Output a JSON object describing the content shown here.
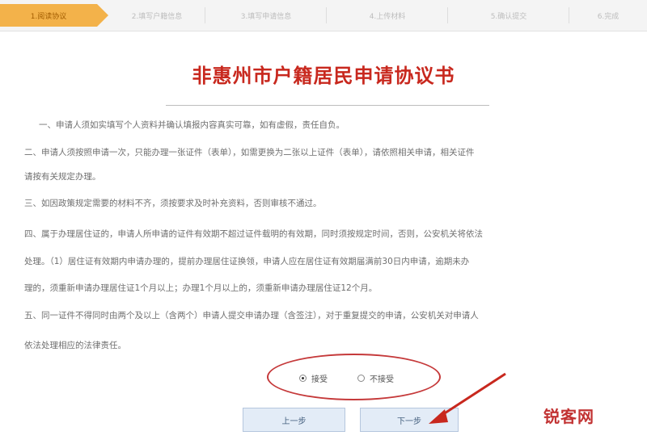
{
  "steps": [
    {
      "label": "1.阅读协议"
    },
    {
      "label": "2.填写户籍信息"
    },
    {
      "label": "3.填写申请信息"
    },
    {
      "label": "4.上传材料"
    },
    {
      "label": "5.确认提交"
    },
    {
      "label": "6.完成"
    }
  ],
  "title": "非惠州市户籍居民申请协议书",
  "items": [
    "一、申请人须如实填写个人资料并确认填报内容真实可靠，如有虚假，责任自负。",
    "二、申请人须按照申请一次，只能办理一张证件（表单），如需更换为二张以上证件（表单），请依照相关申请，相关证件",
    "    请按有关规定办理。",
    "三、如因政策规定需要的材料不齐，须按要求及时补充资料，否则审核不通过。",
    "四、属于办理居住证的，申请人所申请的证件有效期不超过证件载明的有效期，同时须按规定时间，否则，公安机关将依法",
    "    处理。（1）居住证有效期内申请办理的，提前办理居住证换领，申请人应在居住证有效期届满前30日内申请，逾期未办",
    "    理的，须重新申请办理居住证1个月以上；办理1个月以上的，须重新申请办理居住证12个月。",
    "五、同一证件不得同时由两个及以上（含两个）申请人提交申请办理（含签注），对于重复提交的申请，公安机关对申请人",
    "    依法处理相应的法律责任。"
  ],
  "radio": {
    "agree_label": "接受",
    "disagree_label": "不接受",
    "selected": "agree"
  },
  "buttons": {
    "prev_label": "上一步",
    "next_label": "下一步"
  },
  "watermark": "锐客网",
  "colors": {
    "title": "#c8281e",
    "active_step": "#f3b24a",
    "highlight": "#c5393a"
  }
}
